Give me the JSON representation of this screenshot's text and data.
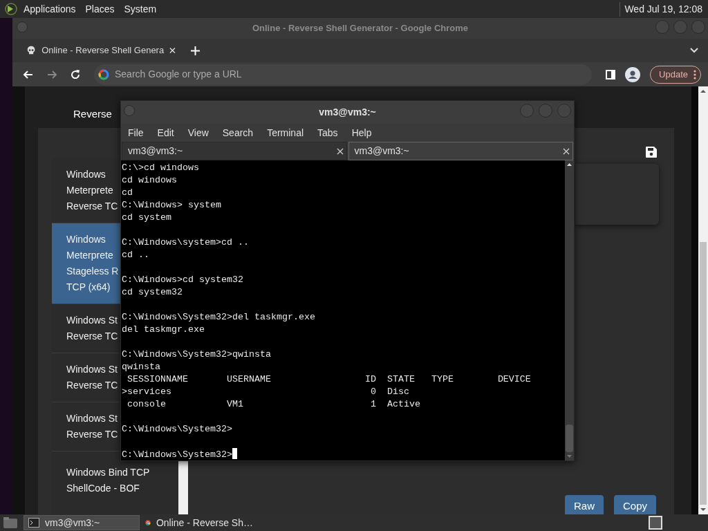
{
  "top_panel": {
    "menus": [
      "Applications",
      "Places",
      "System"
    ],
    "clock": "Wed Jul 19, 12:08"
  },
  "browser": {
    "title": "Online - Reverse Shell Generator - Google Chrome",
    "tabs": [
      {
        "title": "Online - Reverse Shell Genera",
        "selected": true
      }
    ],
    "nav": [
      {
        "kind": "back",
        "disabled": false
      },
      {
        "kind": "forward",
        "disabled": true
      },
      {
        "kind": "reload",
        "disabled": false
      }
    ],
    "address_placeholder": "Search Google or type a URL",
    "update_button": "Update",
    "page": {
      "heading": "Reverse",
      "payloads": [
        {
          "label": "Windows\nMeterprete\nReverse TC",
          "selected": false
        },
        {
          "label": "Windows\nMeterprete\nStageless R\nTCP (x64)",
          "selected": true
        },
        {
          "label": "Windows St\nReverse TC",
          "selected": false
        },
        {
          "label": "Windows St\nReverse TC",
          "selected": false
        },
        {
          "label": "Windows St\nReverse TC",
          "selected": false
        },
        {
          "label": "Windows Bind TCP\nShellCode - BOF",
          "selected": false
        }
      ],
      "buttons": [
        "Raw",
        "Copy"
      ]
    }
  },
  "terminal": {
    "title": "vm3@vm3:~",
    "menus": [
      "File",
      "Edit",
      "View",
      "Search",
      "Terminal",
      "Tabs",
      "Help"
    ],
    "tabs": [
      {
        "title": "vm3@vm3:~",
        "selected": true
      },
      {
        "title": "vm3@vm3:~",
        "selected": false
      }
    ],
    "output": "C:\\>cd windows\ncd windows\ncd\nC:\\Windows> system\ncd system\n\nC:\\Windows\\system>cd ..\ncd ..\n\nC:\\Windows>cd system32\ncd system32\n\nC:\\Windows\\System32>del taskmgr.exe\ndel taskmgr.exe\n\nC:\\Windows\\System32>qwinsta\nqwinsta\n SESSIONNAME       USERNAME                 ID  STATE   TYPE        DEVICE\n>services                                    0  Disc\n console           VM1                       1  Active\n\nC:\\Windows\\System32>\n\nC:\\Windows\\System32>"
  },
  "taskbar": {
    "tasks": [
      {
        "label": "vm3@vm3:~",
        "kind": "terminal",
        "selected": true
      },
      {
        "label": "Online - Reverse Sh…",
        "kind": "browser",
        "selected": false
      }
    ]
  }
}
